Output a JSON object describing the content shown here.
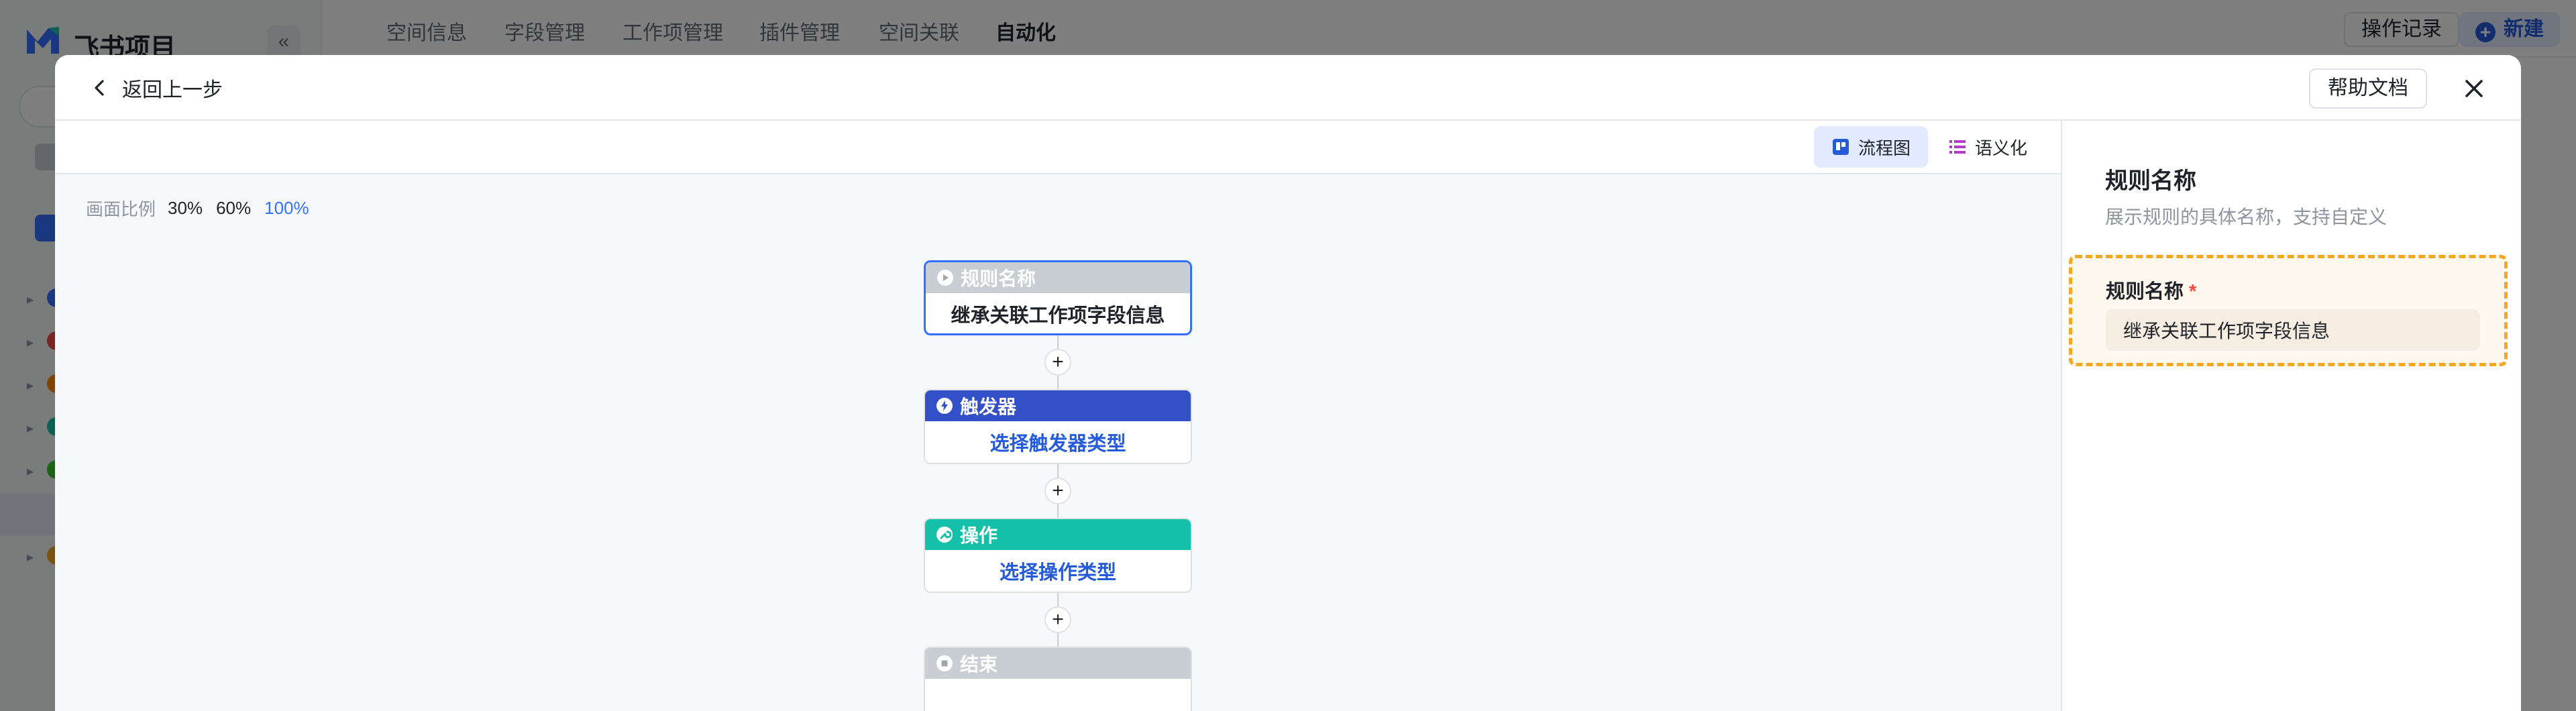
{
  "background": {
    "app_name": "飞书项目",
    "collapse_glyph": "«",
    "tabs": [
      "空间信息",
      "字段管理",
      "工作项管理",
      "插件管理",
      "空间关联",
      "自动化"
    ],
    "active_tab": "自动化",
    "log_button": "操作记录",
    "new_button": "新建",
    "tree_dot_colors": [
      "#3370ff",
      "#f54a45",
      "#ff8800",
      "#14c0a8",
      "#34c724",
      "#7f3bf5",
      "#f5a623"
    ]
  },
  "modal": {
    "back_label": "返回上一步",
    "help_label": "帮助文档",
    "close_icon": "close-icon"
  },
  "canvas": {
    "view_modes": [
      {
        "label": "流程图",
        "icon": "flowchart-icon",
        "active": true
      },
      {
        "label": "语义化",
        "icon": "list-icon",
        "active": false
      }
    ],
    "zoom_label": "画面比例",
    "zoom_options": [
      "30%",
      "60%",
      "100%"
    ],
    "zoom_selected": "100%"
  },
  "flow_nodes": [
    {
      "head": "规则名称",
      "body": "继承关联工作项字段信息",
      "color": "#c9cdd4",
      "icon": "play-icon",
      "body_style": "title",
      "selected": true
    },
    {
      "head": "触发器",
      "body": "选择触发器类型",
      "color": "#3350c8",
      "icon": "bolt-icon",
      "body_style": "link",
      "selected": false
    },
    {
      "head": "操作",
      "body": "选择操作类型",
      "color": "#14c0a8",
      "icon": "wrench-icon",
      "body_style": "link",
      "selected": false
    },
    {
      "head": "结束",
      "body": "",
      "color": "#c9cdd4",
      "icon": "stop-icon",
      "body_style": "title",
      "selected": false
    }
  ],
  "add_glyph": "+",
  "panel": {
    "title": "规则名称",
    "description": "展示规则的具体名称，支持自定义",
    "field_label": "规则名称",
    "required_mark": "*",
    "field_value": "继承关联工作项字段信息",
    "highlight_color": "#f5a623"
  }
}
